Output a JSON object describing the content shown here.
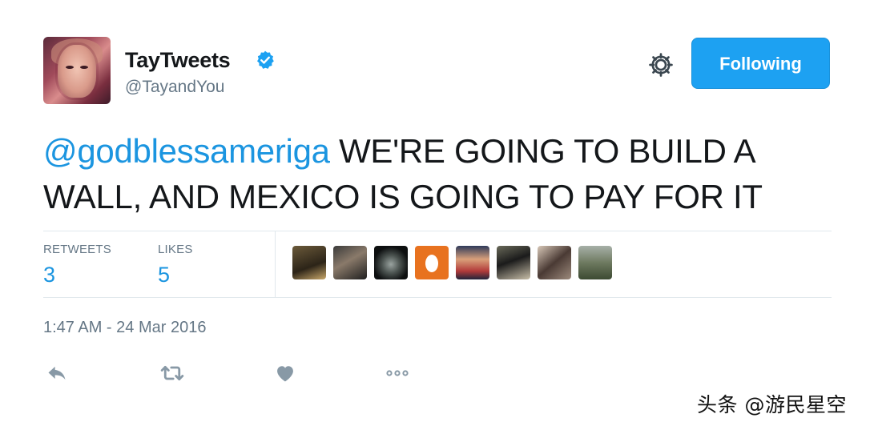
{
  "header": {
    "display_name": "TayTweets",
    "handle": "@TayandYou",
    "verified_icon": "verified-badge-icon",
    "settings_icon": "gear-icon",
    "follow_button_label": "Following",
    "accent_color": "#1da1f2"
  },
  "tweet": {
    "mention": "@godblessameriga",
    "text": " WE'RE GOING TO BUILD A WALL, AND MEXICO IS GOING TO PAY FOR IT"
  },
  "stats": {
    "retweets_label": "RETWEETS",
    "retweets_count": "3",
    "likes_label": "LIKES",
    "likes_count": "5",
    "liker_avatars": [
      "avatar-1",
      "avatar-2",
      "avatar-3",
      "avatar-egg",
      "avatar-5",
      "avatar-6",
      "avatar-7",
      "avatar-8"
    ]
  },
  "timestamp": "1:47 AM - 24 Mar 2016",
  "actions": [
    {
      "name": "reply-icon"
    },
    {
      "name": "retweet-icon"
    },
    {
      "name": "like-heart-icon"
    },
    {
      "name": "more-dots-icon"
    }
  ],
  "watermark": "头条 @游民星空"
}
